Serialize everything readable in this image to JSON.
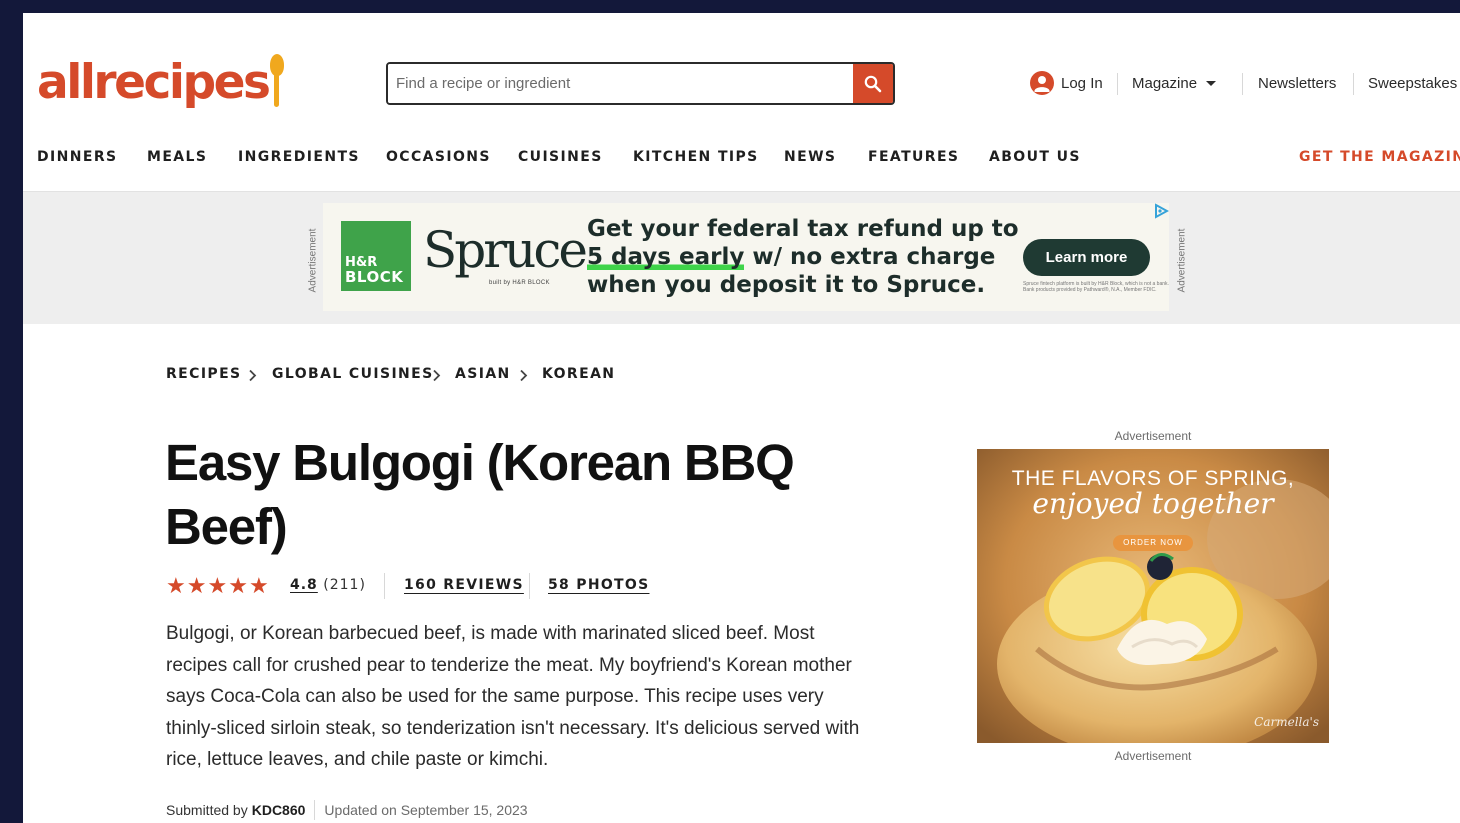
{
  "header": {
    "logo_text": "allrecipes",
    "search_placeholder": "Find a recipe or ingredient",
    "login_label": "Log In",
    "magazine_label": "Magazine",
    "newsletters_label": "Newsletters",
    "sweepstakes_label": "Sweepstakes"
  },
  "nav": {
    "items": [
      "DINNERS",
      "MEALS",
      "INGREDIENTS",
      "OCCASIONS",
      "CUISINES",
      "KITCHEN TIPS",
      "NEWS",
      "FEATURES",
      "ABOUT US"
    ],
    "cta": "GET THE MAGAZINE"
  },
  "banner_ad": {
    "label": "Advertisement",
    "hrblock_line1": "H&R",
    "hrblock_line2": "BLOCK",
    "brand": "Spruce",
    "brand_sub": "built by H&R BLOCK",
    "headline_line1": "Get your federal tax refund up to",
    "headline_highlight": "5 days early",
    "headline_line2_rest": " w/ no extra charge",
    "headline_line3": "when you deposit it to Spruce.",
    "cta_label": "Learn more",
    "fine_print": "Spruce fintech platform is built by H&R Block, which is not a bank. Bank products provided by Pathward®, N.A., Member FDIC."
  },
  "breadcrumb": [
    "RECIPES",
    "GLOBAL CUISINES",
    "ASIAN",
    "KOREAN"
  ],
  "recipe": {
    "title": "Easy Bulgogi (Korean BBQ Beef)",
    "rating_value": "4.8",
    "rating_stars": 5,
    "rating_count": "(211)",
    "reviews_label": "160 REVIEWS",
    "photos_label": "58 PHOTOS",
    "description": "Bulgogi, or Korean barbecued beef, is made with marinated sliced beef. Most recipes call for crushed pear to tenderize the meat. My boyfriend's Korean mother says Coca-Cola can also be used for the same purpose. This recipe uses very thinly-sliced sirloin steak, so tenderization isn't necessary. It's delicious served with rice, lettuce leaves, and chile paste or kimchi.",
    "submitted_prefix": "Submitted by",
    "author": "KDC860",
    "updated": "Updated on September 15, 2023"
  },
  "side_ad": {
    "label_top": "Advertisement",
    "label_bottom": "Advertisement",
    "headline": "THE FLAVORS OF SPRING,",
    "subline": "enjoyed together",
    "cta": "ORDER NOW",
    "brand": "Carmella's"
  },
  "colors": {
    "brand": "#d54a2a",
    "logo_accent": "#f0a81e",
    "ad_green": "#3fa34a",
    "ad_button": "#1f3a33",
    "frame": "#13183a"
  }
}
